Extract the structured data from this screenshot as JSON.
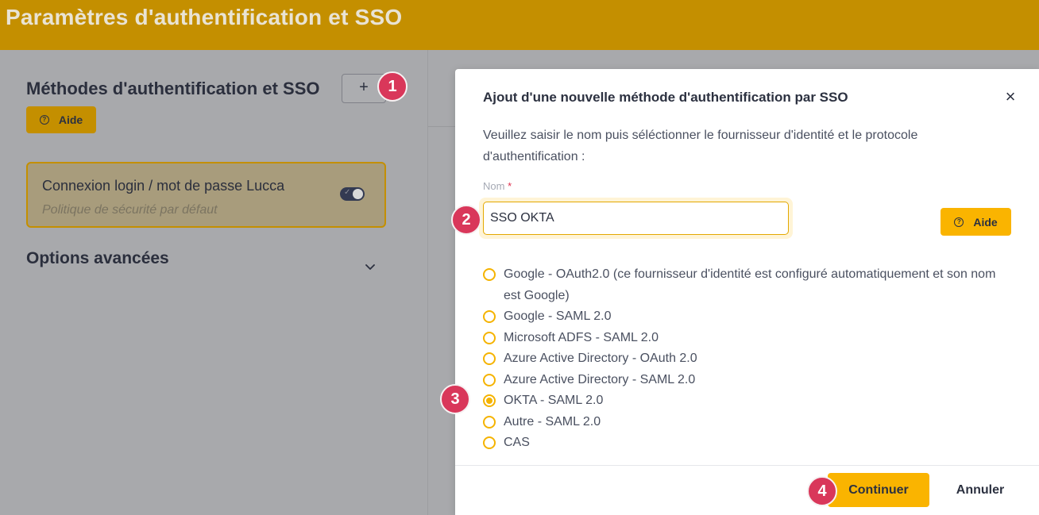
{
  "header": {
    "title": "Paramètres d'authentification et SSO"
  },
  "left": {
    "methods_title": "Méthodes d'authentification et SSO",
    "add_label": "+",
    "help_label": "Aide",
    "card": {
      "title": "Connexion login / mot de passe Lucca",
      "subtitle": "Politique de sécurité par défaut",
      "toggle_on": true
    },
    "advanced_title": "Options avancées"
  },
  "modal": {
    "title": "Ajout d'une nouvelle méthode d'authentification par SSO",
    "close_label": "×",
    "description": "Veuillez saisir le nom puis séléctionner le fournisseur d'identité et le protocole d'authentification :",
    "name_label": "Nom",
    "required_mark": "*",
    "name_value": "SSO OKTA",
    "help_label": "Aide",
    "options": [
      {
        "label": "Google - OAuth2.0 (ce fournisseur d'identité est configuré automatiquement et son nom est Google)",
        "checked": false
      },
      {
        "label": "Google - SAML 2.0",
        "checked": false
      },
      {
        "label": "Microsoft ADFS - SAML 2.0",
        "checked": false
      },
      {
        "label": "Azure Active Directory - OAuth 2.0",
        "checked": false
      },
      {
        "label": "Azure Active Directory - SAML 2.0",
        "checked": false
      },
      {
        "label": "OKTA - SAML 2.0",
        "checked": true
      },
      {
        "label": "Autre - SAML 2.0",
        "checked": false
      },
      {
        "label": "CAS",
        "checked": false
      }
    ],
    "continue_label": "Continuer",
    "cancel_label": "Annuler"
  },
  "badges": [
    "1",
    "2",
    "3",
    "4"
  ],
  "colors": {
    "brand": "#c48f00",
    "accent": "#fab400",
    "badge": "#d9375a"
  }
}
